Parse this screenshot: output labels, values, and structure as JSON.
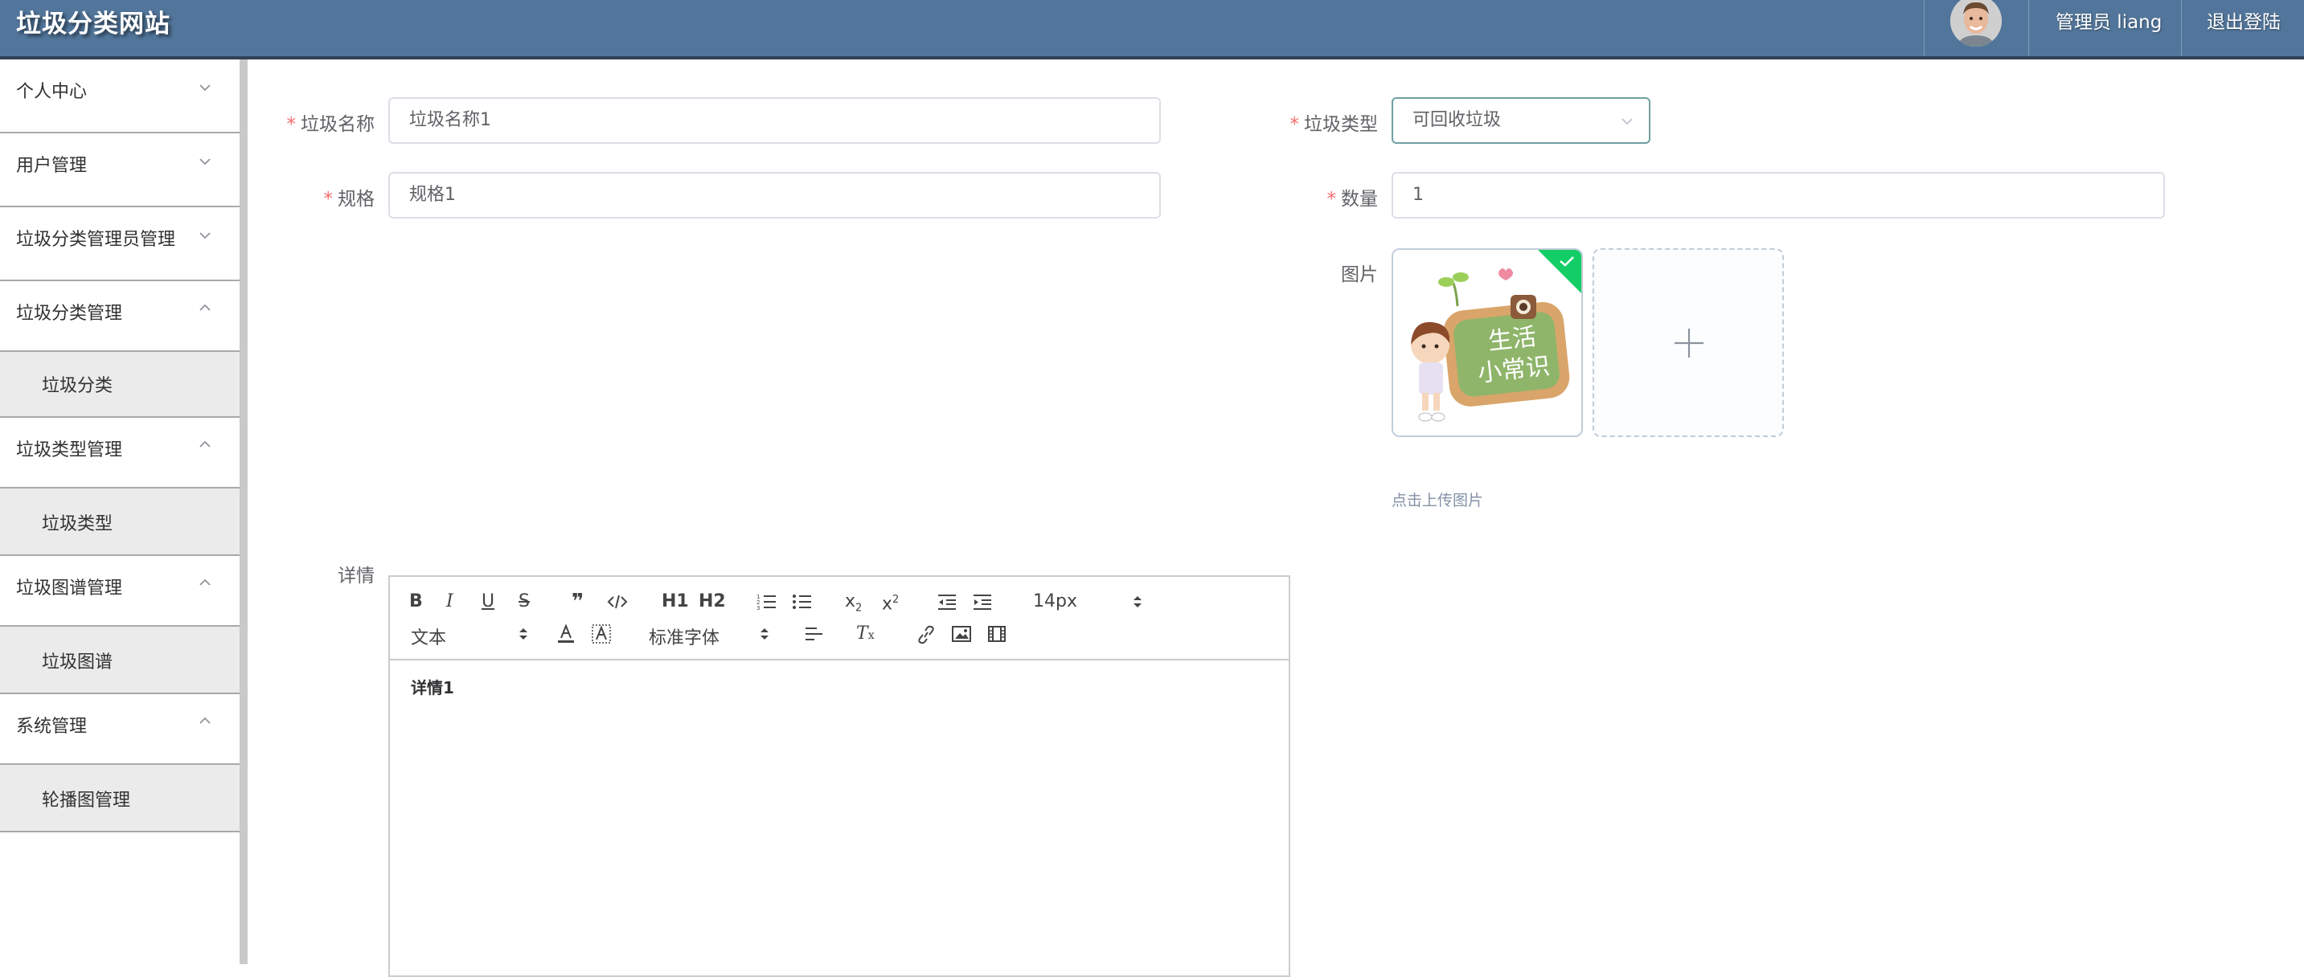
{
  "header": {
    "site_title": "垃圾分类网站",
    "user_label": "管理员 liang",
    "logout_label": "退出登陆"
  },
  "sidebar": {
    "items": [
      {
        "label": "个人中心",
        "expanded": false
      },
      {
        "label": "用户管理",
        "expanded": false
      },
      {
        "label": "垃圾分类管理员管理",
        "expanded": false
      },
      {
        "label": "垃圾分类管理",
        "expanded": true,
        "sub": "垃圾分类"
      },
      {
        "label": "垃圾类型管理",
        "expanded": true,
        "sub": "垃圾类型"
      },
      {
        "label": "垃圾图谱管理",
        "expanded": true,
        "sub": "垃圾图谱"
      },
      {
        "label": "系统管理",
        "expanded": true,
        "sub": "轮播图管理"
      }
    ]
  },
  "form": {
    "name": {
      "label": "垃圾名称",
      "value": "垃圾名称1"
    },
    "type": {
      "label": "垃圾类型",
      "value": "可回收垃圾"
    },
    "spec": {
      "label": "规格",
      "value": "规格1"
    },
    "quantity": {
      "label": "数量",
      "value": "1"
    },
    "image": {
      "label": "图片",
      "tip": "点击上传图片",
      "preview_text": "生活小常识"
    },
    "detail": {
      "label": "详情",
      "content": "详情1"
    }
  },
  "editor": {
    "toolbar": {
      "header1": "H1",
      "header2": "H2",
      "size": "14px",
      "text_style": "文本",
      "font": "标准字体"
    }
  },
  "colors": {
    "header_bg": "#52769b",
    "required": "#f56c6c",
    "success": "#13ce66"
  }
}
